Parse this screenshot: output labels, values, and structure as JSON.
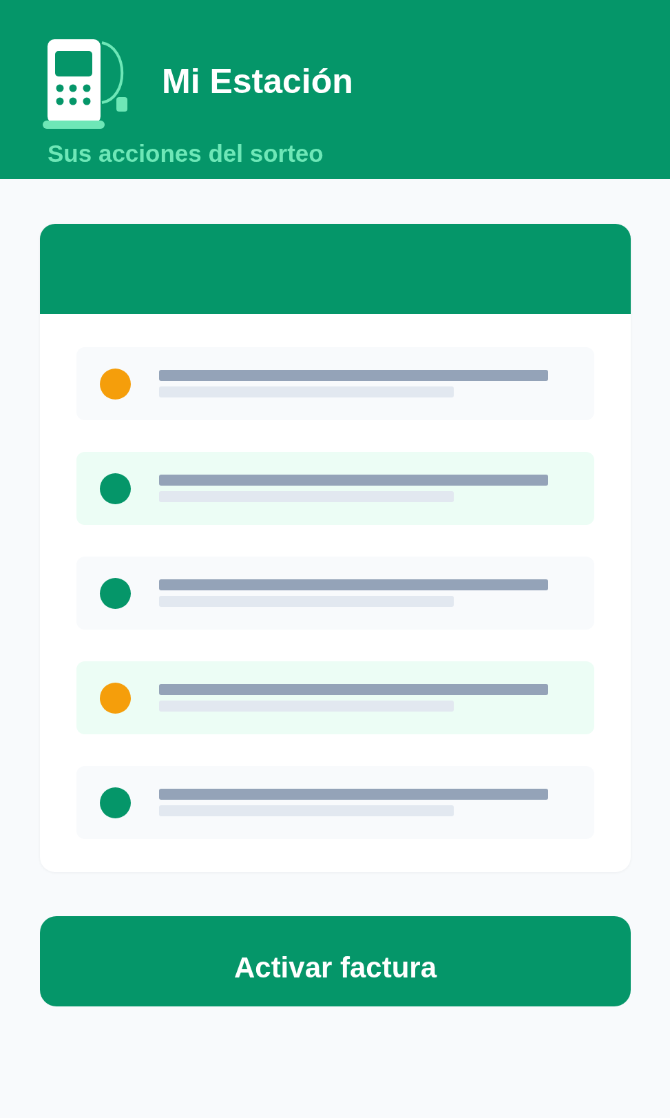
{
  "header": {
    "title": "Mi Estación",
    "subtitle": "Sus acciones del sorteo"
  },
  "card": {
    "rows": [
      {
        "color": "#f59e0b"
      },
      {
        "color": "#059669"
      },
      {
        "color": "#059669"
      },
      {
        "color": "#f59e0b"
      },
      {
        "color": "#059669"
      }
    ]
  },
  "button": {
    "label": "Activar factura"
  }
}
